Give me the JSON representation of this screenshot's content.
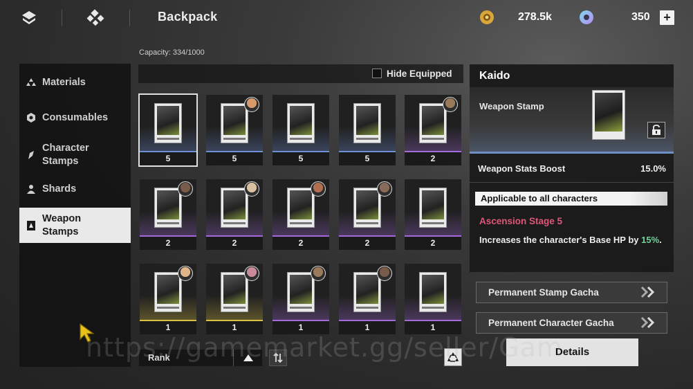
{
  "header": {
    "title": "Backpack",
    "gold_value": "278.5k",
    "gem_value": "350",
    "add_label": "+"
  },
  "capacity": "Capacity: 334/1000",
  "sidebar": {
    "items": [
      {
        "label": "Materials",
        "icon": "triangle-cluster-icon"
      },
      {
        "label": "Consumables",
        "icon": "hexagon-icon"
      },
      {
        "label": "Character Stamps",
        "icon": "brush-icon"
      },
      {
        "label": "Shards",
        "icon": "person-icon"
      },
      {
        "label": "Weapon Stamps",
        "icon": "stamp-icon"
      }
    ],
    "active_index": 4
  },
  "filter": {
    "hide_equipped_label": "Hide Equipped",
    "hide_equipped_checked": false
  },
  "grid": {
    "cards": [
      {
        "count": "5",
        "rarity": "blue",
        "avatar": false
      },
      {
        "count": "5",
        "rarity": "blue",
        "avatar": true
      },
      {
        "count": "5",
        "rarity": "blue",
        "avatar": false
      },
      {
        "count": "5",
        "rarity": "blue",
        "avatar": false
      },
      {
        "count": "2",
        "rarity": "purple",
        "avatar": true
      },
      {
        "count": "2",
        "rarity": "purple",
        "avatar": true
      },
      {
        "count": "2",
        "rarity": "purple",
        "avatar": true
      },
      {
        "count": "2",
        "rarity": "purple",
        "avatar": true
      },
      {
        "count": "2",
        "rarity": "purple",
        "avatar": true
      },
      {
        "count": "2",
        "rarity": "purple",
        "avatar": false
      },
      {
        "count": "1",
        "rarity": "gold",
        "avatar": true
      },
      {
        "count": "1",
        "rarity": "gold",
        "avatar": true
      },
      {
        "count": "1",
        "rarity": "purple",
        "avatar": true
      },
      {
        "count": "1",
        "rarity": "purple",
        "avatar": true
      },
      {
        "count": "1",
        "rarity": "purple",
        "avatar": false
      }
    ]
  },
  "detail": {
    "name": "Kaido",
    "type": "Weapon Stamp",
    "stat_label": "Weapon Stats Boost",
    "stat_value": "15.0%",
    "applicable": "Applicable to all characters",
    "ascension": "Ascension Stage 5",
    "desc_main": "Increases the character's Base HP by ",
    "desc_highlight": "15%",
    "desc_end": "."
  },
  "actions": {
    "permanent_stamp_gacha": "Permanent Stamp Gacha",
    "permanent_character_gacha": "Permanent Character Gacha",
    "details": "Details"
  },
  "sort": {
    "label": "Rank"
  },
  "watermark": "https://gamemarket.gg/seller/Gam",
  "colors": {
    "blue": "#6f8fd6",
    "purple": "#a36ad9",
    "gold": "#d9c043",
    "ascension": "#e0567a",
    "highlight": "#6fd39a"
  }
}
